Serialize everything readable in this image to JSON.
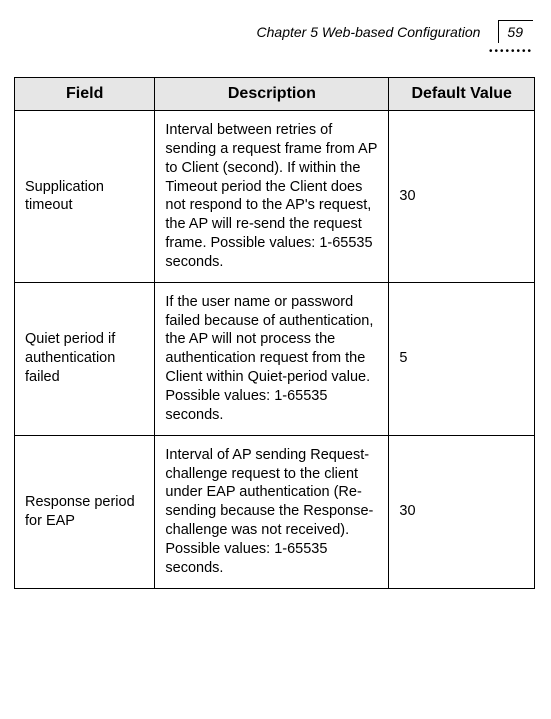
{
  "header": {
    "chapter_title": "Chapter 5 Web-based Configuration",
    "page_number": "59"
  },
  "table": {
    "headers": {
      "field": "Field",
      "description": "Description",
      "default_value": "Default Value"
    },
    "rows": [
      {
        "field": "Supplication timeout",
        "description": "Interval between retries of sending a request frame from AP to Client (second). If within the Timeout period the Client does not respond to the AP's request, the AP will re-send the request frame.  Possible values: 1-65535 seconds.",
        "default_value": "30"
      },
      {
        "field": "Quiet period if authentication failed",
        "description": "If the user name or password failed because of authentication, the AP will not process the authentication request from the Client within Quiet-period value. Possible values: 1-65535 seconds.",
        "default_value": "5"
      },
      {
        "field": "Response period for EAP",
        "description": "Interval of AP sending Request-challenge request to the client under EAP authentication (Re-sending because the Response-challenge was not received). Possible values: 1-65535 seconds.",
        "default_value": "30"
      }
    ]
  }
}
